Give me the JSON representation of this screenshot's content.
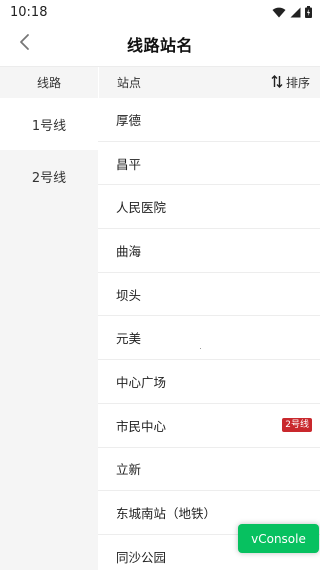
{
  "status_bar": {
    "time": "10:18",
    "icons": [
      "wifi-icon",
      "signal-icon",
      "battery-icon"
    ]
  },
  "header": {
    "back_icon": "chevron-left-icon",
    "title": "线路站名"
  },
  "columns": {
    "left_label": "线路",
    "right_label": "站点",
    "sort_label": "排序",
    "sort_icon": "sort-arrows-icon"
  },
  "lines": [
    {
      "label": "1号线",
      "active": true
    },
    {
      "label": "2号线",
      "active": false
    }
  ],
  "stations": [
    {
      "name": "厚德",
      "tag": ""
    },
    {
      "name": "昌平",
      "tag": ""
    },
    {
      "name": "人民医院",
      "tag": ""
    },
    {
      "name": "曲海",
      "tag": ""
    },
    {
      "name": "坝头",
      "tag": ""
    },
    {
      "name": "元美",
      "tag": ""
    },
    {
      "name": "中心广场",
      "tag": ""
    },
    {
      "name": "市民中心",
      "tag": "2号线"
    },
    {
      "name": "立新",
      "tag": ""
    },
    {
      "name": "东城南站（地铁）",
      "tag": ""
    },
    {
      "name": "同沙公园",
      "tag": ""
    }
  ],
  "vconsole": {
    "label": "vConsole"
  },
  "colors": {
    "tag_bg": "#c9282d",
    "vconsole_bg": "#07c160",
    "sidebar_bg": "#f5f5f5"
  }
}
